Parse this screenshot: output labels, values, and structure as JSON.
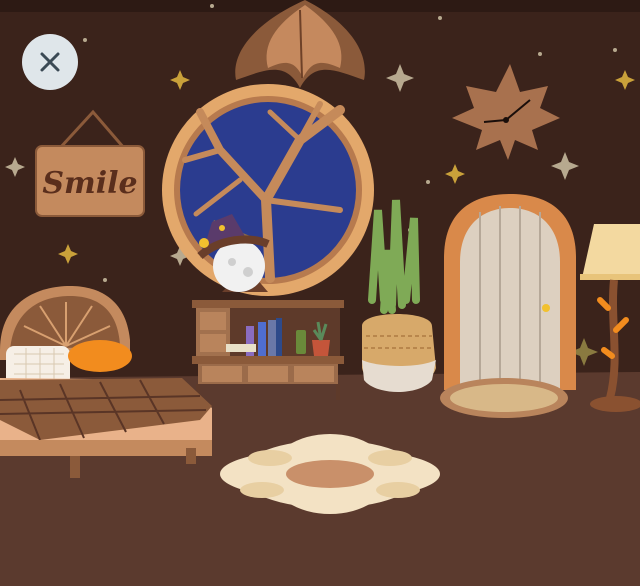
{
  "game": {
    "title": "",
    "sign_text": "Smile"
  },
  "controls": {
    "close_icon": "close-icon"
  },
  "colors": {
    "wall": "#3b231b",
    "floor": "#5b3a2e",
    "window_sky": "#2b3c8f",
    "wood": "#e0a66a",
    "accent_orange": "#f28c1e",
    "star": "#c4b28a"
  }
}
